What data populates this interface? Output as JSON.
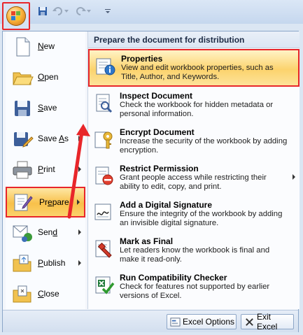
{
  "qat": {
    "icons": [
      "office-button",
      "save-icon",
      "undo-icon",
      "redo-icon",
      "customize-qat-icon"
    ]
  },
  "left_menu": [
    {
      "label": "New",
      "key": "N",
      "rest": "ew",
      "icon": "new-document-icon"
    },
    {
      "label": "Open",
      "key": "O",
      "rest": "pen",
      "icon": "open-folder-icon"
    },
    {
      "label": "Save",
      "key": "S",
      "rest": "ave",
      "icon": "save-disk-icon"
    },
    {
      "label": "Save As",
      "pre": "Save ",
      "key": "A",
      "rest": "s",
      "icon": "save-as-icon"
    },
    {
      "label": "Print",
      "key": "P",
      "rest": "rint",
      "icon": "printer-icon"
    },
    {
      "label": "Prepare",
      "pre": "Pr",
      "key": "e",
      "rest": "pare",
      "icon": "prepare-icon"
    },
    {
      "label": "Send",
      "pre": "Sen",
      "key": "d",
      "rest": "",
      "icon": "send-icon"
    },
    {
      "label": "Publish",
      "key": "P",
      "pre": "",
      "rest": "ublish",
      "icon": "publish-icon"
    },
    {
      "label": "Close",
      "key": "C",
      "rest": "lose",
      "icon": "close-folder-icon"
    }
  ],
  "right_pane": {
    "header": "Prepare the document for distribution",
    "items": [
      {
        "title": "Properties",
        "desc": "View and edit workbook properties, such as Title, Author, and Keywords.",
        "icon": "properties-icon"
      },
      {
        "title": "Inspect Document",
        "desc": "Check the workbook for hidden metadata or personal information.",
        "icon": "inspect-document-icon"
      },
      {
        "title": "Encrypt Document",
        "desc": "Increase the security of the workbook by adding encryption.",
        "icon": "encrypt-key-icon"
      },
      {
        "title": "Restrict Permission",
        "desc": "Grant people access while restricting their ability to edit, copy, and print.",
        "icon": "restrict-permission-icon"
      },
      {
        "title": "Add a Digital Signature",
        "desc": "Ensure the integrity of the workbook by adding an invisible digital signature.",
        "icon": "digital-signature-icon"
      },
      {
        "title": "Mark as Final",
        "desc": "Let readers know the workbook is final and make it read-only.",
        "icon": "mark-final-icon"
      },
      {
        "title": "Run Compatibility Checker",
        "desc": "Check for features not supported by earlier versions of Excel.",
        "icon": "compatibility-check-icon"
      }
    ]
  },
  "footer": {
    "options_label": "Excel Options",
    "exit_label": "Exit Excel"
  },
  "colors": {
    "highlight_border": "#e8262a",
    "highlight_fill": "#fbd36c",
    "arrow": "#e8262a"
  }
}
